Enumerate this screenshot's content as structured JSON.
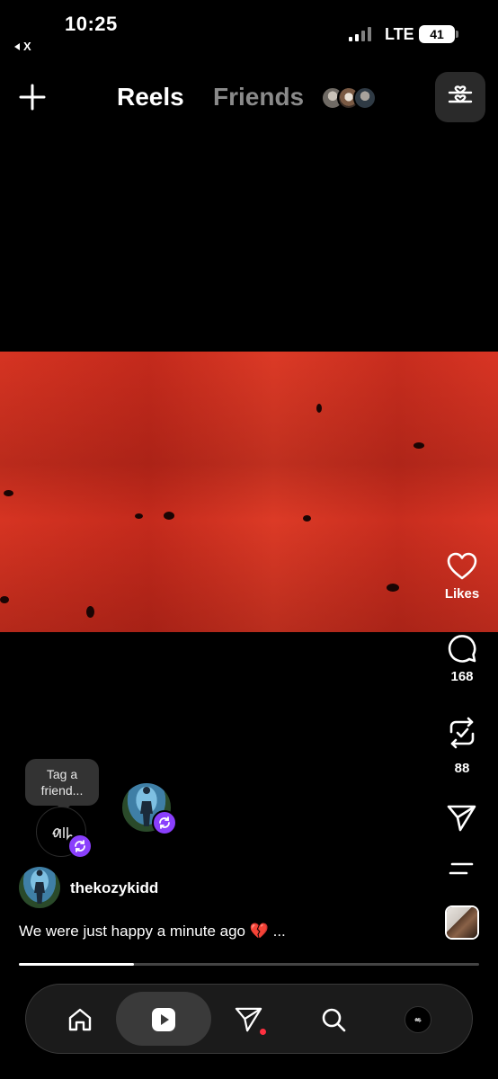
{
  "status_bar": {
    "time": "10:25",
    "back_app_label": "X",
    "network": "LTE",
    "battery": "41"
  },
  "header": {
    "create_icon": "plus-icon",
    "tabs": [
      {
        "label": "Reels",
        "active": true
      },
      {
        "label": "Friends",
        "active": false
      }
    ],
    "filter_icon": "sliders-heart-icon"
  },
  "reel": {
    "video_colors": {
      "primary": "#d63422",
      "speck": "#1a0504"
    },
    "actions": {
      "like": {
        "icon": "heart-icon",
        "label": "Likes"
      },
      "comment": {
        "icon": "comment-icon",
        "count": "168"
      },
      "repost": {
        "icon": "repost-icon",
        "count": "88"
      },
      "share": {
        "icon": "send-icon"
      },
      "more": {
        "icon": "more-icon"
      },
      "audio": {
        "icon": "audio-thumbnail-icon"
      }
    },
    "tooltip": "Tag a friend...",
    "author": {
      "username": "thekozykidd"
    },
    "caption": "We were just happy a minute ago 💔 ...",
    "progress": 0.25,
    "accent_color": "#8a3ffc"
  },
  "bottom_nav": {
    "items": [
      {
        "name": "home",
        "icon": "home-icon"
      },
      {
        "name": "reels",
        "icon": "reels-icon",
        "active": true
      },
      {
        "name": "direct",
        "icon": "send-icon",
        "notification": true
      },
      {
        "name": "search",
        "icon": "search-icon"
      },
      {
        "name": "profile",
        "icon": "profile-avatar-icon"
      }
    ]
  }
}
